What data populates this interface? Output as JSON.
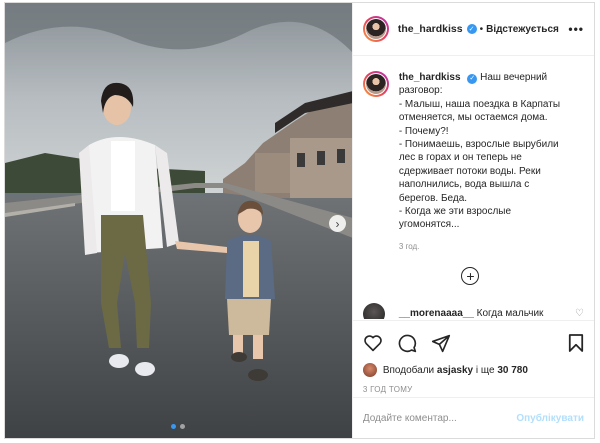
{
  "post": {
    "username": "the_hardkiss",
    "follow_label": "Відстежується",
    "more_label": "•••",
    "verified_glyph": "✓",
    "caption": {
      "username": "the_hardkiss",
      "lines": [
        "Наш вечерний",
        "разговор:",
        "- Малыш, наша поездка в Карпаты",
        "отменяется, мы остаемся дома.",
        "- Почему?!",
        "- Понимаешь, взрослые вырубили",
        "лес в горах и он теперь не",
        "сдерживает потоки воды. Реки",
        "наполнились, вода вышла с",
        "берегов. Беда.",
        "- Когда же эти взрослые",
        "угомонятся..."
      ],
      "time": "3 год."
    },
    "load_more_glyph": "+",
    "comment": {
      "username": "__morenaaaa__",
      "text": "Когда мальчик"
    },
    "likes": {
      "prefix": "Вподобали",
      "user": "asjasky",
      "middle": "і ще",
      "count": "30 780"
    },
    "posted_time": "3 ГОД ТОМУ",
    "add_comment_placeholder": "Додайте коментар...",
    "publish_label": "Опублікувати",
    "next_glyph": "›",
    "icons": [
      "heart-icon",
      "comment-icon",
      "share-icon",
      "bookmark-icon",
      "verified-icon",
      "plus-circle-icon",
      "chevron-right-icon"
    ]
  }
}
